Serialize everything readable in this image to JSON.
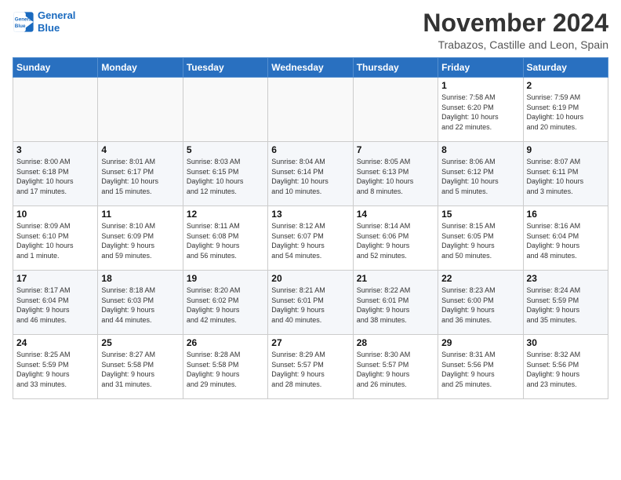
{
  "logo": {
    "line1": "General",
    "line2": "Blue"
  },
  "header": {
    "month": "November 2024",
    "location": "Trabazos, Castille and Leon, Spain"
  },
  "weekdays": [
    "Sunday",
    "Monday",
    "Tuesday",
    "Wednesday",
    "Thursday",
    "Friday",
    "Saturday"
  ],
  "weeks": [
    [
      {
        "day": "",
        "info": ""
      },
      {
        "day": "",
        "info": ""
      },
      {
        "day": "",
        "info": ""
      },
      {
        "day": "",
        "info": ""
      },
      {
        "day": "",
        "info": ""
      },
      {
        "day": "1",
        "info": "Sunrise: 7:58 AM\nSunset: 6:20 PM\nDaylight: 10 hours\nand 22 minutes."
      },
      {
        "day": "2",
        "info": "Sunrise: 7:59 AM\nSunset: 6:19 PM\nDaylight: 10 hours\nand 20 minutes."
      }
    ],
    [
      {
        "day": "3",
        "info": "Sunrise: 8:00 AM\nSunset: 6:18 PM\nDaylight: 10 hours\nand 17 minutes."
      },
      {
        "day": "4",
        "info": "Sunrise: 8:01 AM\nSunset: 6:17 PM\nDaylight: 10 hours\nand 15 minutes."
      },
      {
        "day": "5",
        "info": "Sunrise: 8:03 AM\nSunset: 6:15 PM\nDaylight: 10 hours\nand 12 minutes."
      },
      {
        "day": "6",
        "info": "Sunrise: 8:04 AM\nSunset: 6:14 PM\nDaylight: 10 hours\nand 10 minutes."
      },
      {
        "day": "7",
        "info": "Sunrise: 8:05 AM\nSunset: 6:13 PM\nDaylight: 10 hours\nand 8 minutes."
      },
      {
        "day": "8",
        "info": "Sunrise: 8:06 AM\nSunset: 6:12 PM\nDaylight: 10 hours\nand 5 minutes."
      },
      {
        "day": "9",
        "info": "Sunrise: 8:07 AM\nSunset: 6:11 PM\nDaylight: 10 hours\nand 3 minutes."
      }
    ],
    [
      {
        "day": "10",
        "info": "Sunrise: 8:09 AM\nSunset: 6:10 PM\nDaylight: 10 hours\nand 1 minute."
      },
      {
        "day": "11",
        "info": "Sunrise: 8:10 AM\nSunset: 6:09 PM\nDaylight: 9 hours\nand 59 minutes."
      },
      {
        "day": "12",
        "info": "Sunrise: 8:11 AM\nSunset: 6:08 PM\nDaylight: 9 hours\nand 56 minutes."
      },
      {
        "day": "13",
        "info": "Sunrise: 8:12 AM\nSunset: 6:07 PM\nDaylight: 9 hours\nand 54 minutes."
      },
      {
        "day": "14",
        "info": "Sunrise: 8:14 AM\nSunset: 6:06 PM\nDaylight: 9 hours\nand 52 minutes."
      },
      {
        "day": "15",
        "info": "Sunrise: 8:15 AM\nSunset: 6:05 PM\nDaylight: 9 hours\nand 50 minutes."
      },
      {
        "day": "16",
        "info": "Sunrise: 8:16 AM\nSunset: 6:04 PM\nDaylight: 9 hours\nand 48 minutes."
      }
    ],
    [
      {
        "day": "17",
        "info": "Sunrise: 8:17 AM\nSunset: 6:04 PM\nDaylight: 9 hours\nand 46 minutes."
      },
      {
        "day": "18",
        "info": "Sunrise: 8:18 AM\nSunset: 6:03 PM\nDaylight: 9 hours\nand 44 minutes."
      },
      {
        "day": "19",
        "info": "Sunrise: 8:20 AM\nSunset: 6:02 PM\nDaylight: 9 hours\nand 42 minutes."
      },
      {
        "day": "20",
        "info": "Sunrise: 8:21 AM\nSunset: 6:01 PM\nDaylight: 9 hours\nand 40 minutes."
      },
      {
        "day": "21",
        "info": "Sunrise: 8:22 AM\nSunset: 6:01 PM\nDaylight: 9 hours\nand 38 minutes."
      },
      {
        "day": "22",
        "info": "Sunrise: 8:23 AM\nSunset: 6:00 PM\nDaylight: 9 hours\nand 36 minutes."
      },
      {
        "day": "23",
        "info": "Sunrise: 8:24 AM\nSunset: 5:59 PM\nDaylight: 9 hours\nand 35 minutes."
      }
    ],
    [
      {
        "day": "24",
        "info": "Sunrise: 8:25 AM\nSunset: 5:59 PM\nDaylight: 9 hours\nand 33 minutes."
      },
      {
        "day": "25",
        "info": "Sunrise: 8:27 AM\nSunset: 5:58 PM\nDaylight: 9 hours\nand 31 minutes."
      },
      {
        "day": "26",
        "info": "Sunrise: 8:28 AM\nSunset: 5:58 PM\nDaylight: 9 hours\nand 29 minutes."
      },
      {
        "day": "27",
        "info": "Sunrise: 8:29 AM\nSunset: 5:57 PM\nDaylight: 9 hours\nand 28 minutes."
      },
      {
        "day": "28",
        "info": "Sunrise: 8:30 AM\nSunset: 5:57 PM\nDaylight: 9 hours\nand 26 minutes."
      },
      {
        "day": "29",
        "info": "Sunrise: 8:31 AM\nSunset: 5:56 PM\nDaylight: 9 hours\nand 25 minutes."
      },
      {
        "day": "30",
        "info": "Sunrise: 8:32 AM\nSunset: 5:56 PM\nDaylight: 9 hours\nand 23 minutes."
      }
    ]
  ]
}
